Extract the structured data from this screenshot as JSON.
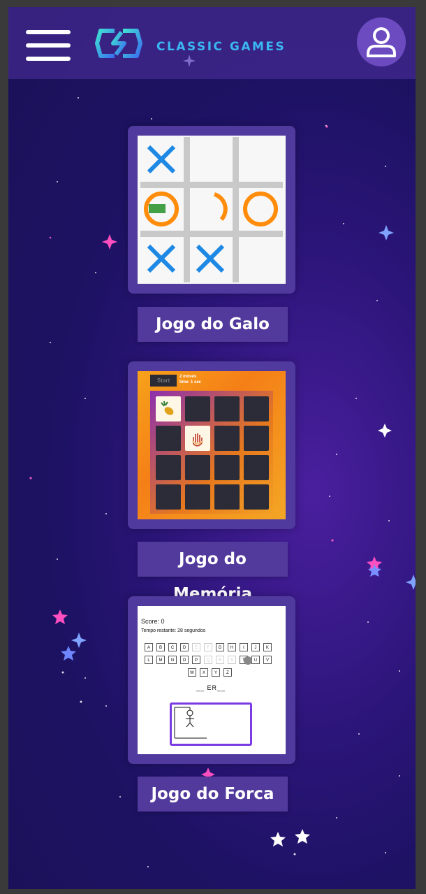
{
  "app": {
    "brand": "CLASSIC GAMES"
  },
  "colors": {
    "background": "#1d1263",
    "topbar": "#3d2a8c",
    "card": "#503a9e",
    "brand_text": "#3bb7f2",
    "accent_purple": "#7a3be2"
  },
  "header": {
    "menu_icon": "hamburger-menu-icon",
    "profile_icon": "user-icon"
  },
  "games": [
    {
      "label": "Jogo do Galo",
      "icon": "tic-tac-toe-thumbnail",
      "board": [
        "X",
        "",
        "",
        "O",
        "O",
        "O",
        "X",
        "X",
        ""
      ]
    },
    {
      "label": "Jogo do Memória",
      "icon": "memory-game-thumbnail",
      "start_label": "Start",
      "moves_text": "2 moves",
      "time_text": "time: 1 sec"
    },
    {
      "label": "Jogo do Forca",
      "icon": "hangman-thumbnail",
      "score_text": "Score: 0",
      "time_text": "Tempo restante: 28 segundos",
      "keys": [
        "A",
        "B",
        "C",
        "D",
        "E",
        "F",
        "G",
        "H",
        "I",
        "J",
        "K",
        "L",
        "M",
        "N",
        "O",
        "P",
        "Q",
        "R",
        "S",
        "T",
        "U",
        "V",
        "W",
        "X",
        "Y",
        "Z"
      ],
      "used_keys": [
        "E",
        "F",
        "Q",
        "R",
        "S"
      ],
      "word_text": "__ ER__"
    }
  ]
}
